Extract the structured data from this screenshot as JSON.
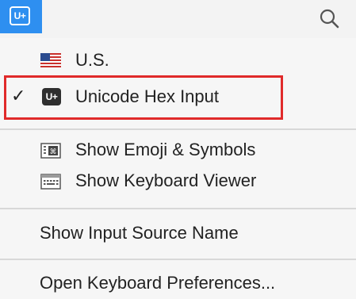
{
  "menubar": {
    "input_source_icon": "U+",
    "search_icon": "search-icon"
  },
  "menu": {
    "items": [
      {
        "label": "U.S.",
        "icon": "us-flag-icon"
      },
      {
        "label": "Unicode Hex Input",
        "icon": "unicode-hex-input-icon",
        "icon_text": "U+",
        "checked": true,
        "checkmark": "✓"
      },
      {
        "label": "Show Emoji & Symbols",
        "icon": "emoji-symbols-viewer-icon"
      },
      {
        "label": "Show Keyboard Viewer",
        "icon": "keyboard-viewer-icon"
      },
      {
        "label": "Show Input Source Name"
      },
      {
        "label": "Open Keyboard Preferences..."
      }
    ]
  },
  "colors": {
    "menubar_highlight": "#2e8ff0",
    "annotation_box": "#e02a2a"
  }
}
